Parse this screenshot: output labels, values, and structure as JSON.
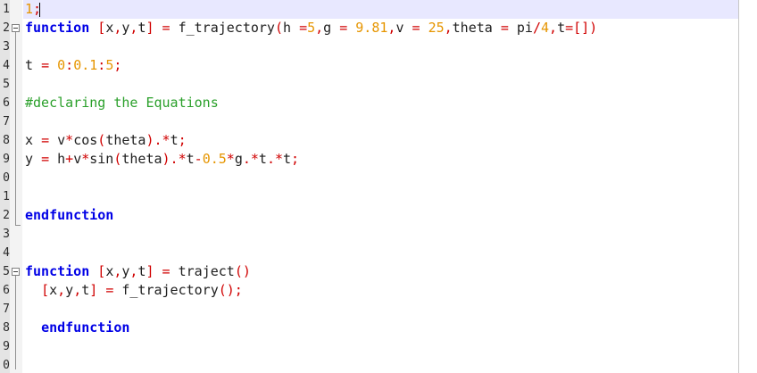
{
  "gutter": {
    "line_numbers": [
      "1",
      "2",
      "3",
      "4",
      "5",
      "6",
      "7",
      "8",
      "9",
      "0",
      "1",
      "2",
      "3",
      "4",
      "5",
      "6",
      "7",
      "8",
      "9",
      "0"
    ]
  },
  "colors": {
    "keyword": "#0000e6",
    "operator": "#d00000",
    "number": "#e69500",
    "comment": "#2ba02b",
    "identifier": "#202020",
    "current_line": "#e8e8ff"
  },
  "lines": [
    [
      {
        "t": "1",
        "c": "num"
      },
      {
        "t": ";",
        "c": "op"
      }
    ],
    [
      {
        "t": "function",
        "c": "kw"
      },
      {
        "t": " ",
        "c": "id"
      },
      {
        "t": "[",
        "c": "op"
      },
      {
        "t": "x",
        "c": "id"
      },
      {
        "t": ",",
        "c": "op"
      },
      {
        "t": "y",
        "c": "id"
      },
      {
        "t": ",",
        "c": "op"
      },
      {
        "t": "t",
        "c": "id"
      },
      {
        "t": "]",
        "c": "op"
      },
      {
        "t": " ",
        "c": "id"
      },
      {
        "t": "=",
        "c": "op"
      },
      {
        "t": " f_trajectory",
        "c": "id"
      },
      {
        "t": "(",
        "c": "op"
      },
      {
        "t": "h ",
        "c": "id"
      },
      {
        "t": "=",
        "c": "op"
      },
      {
        "t": "5",
        "c": "num"
      },
      {
        "t": ",",
        "c": "op"
      },
      {
        "t": "g ",
        "c": "id"
      },
      {
        "t": "=",
        "c": "op"
      },
      {
        "t": " ",
        "c": "id"
      },
      {
        "t": "9.81",
        "c": "num"
      },
      {
        "t": ",",
        "c": "op"
      },
      {
        "t": "v ",
        "c": "id"
      },
      {
        "t": "=",
        "c": "op"
      },
      {
        "t": " ",
        "c": "id"
      },
      {
        "t": "25",
        "c": "num"
      },
      {
        "t": ",",
        "c": "op"
      },
      {
        "t": "theta ",
        "c": "id"
      },
      {
        "t": "=",
        "c": "op"
      },
      {
        "t": " pi",
        "c": "id"
      },
      {
        "t": "/",
        "c": "op"
      },
      {
        "t": "4",
        "c": "num"
      },
      {
        "t": ",",
        "c": "op"
      },
      {
        "t": "t",
        "c": "id"
      },
      {
        "t": "=[])",
        "c": "op"
      }
    ],
    [],
    [
      {
        "t": "t ",
        "c": "id"
      },
      {
        "t": "=",
        "c": "op"
      },
      {
        "t": " ",
        "c": "id"
      },
      {
        "t": "0",
        "c": "num"
      },
      {
        "t": ":",
        "c": "op"
      },
      {
        "t": "0.1",
        "c": "num"
      },
      {
        "t": ":",
        "c": "op"
      },
      {
        "t": "5",
        "c": "num"
      },
      {
        "t": ";",
        "c": "op"
      }
    ],
    [],
    [
      {
        "t": "#declaring the Equations",
        "c": "cm"
      }
    ],
    [],
    [
      {
        "t": "x ",
        "c": "id"
      },
      {
        "t": "=",
        "c": "op"
      },
      {
        "t": " v",
        "c": "id"
      },
      {
        "t": "*",
        "c": "op"
      },
      {
        "t": "cos",
        "c": "id"
      },
      {
        "t": "(",
        "c": "op"
      },
      {
        "t": "theta",
        "c": "id"
      },
      {
        "t": ").*",
        "c": "op"
      },
      {
        "t": "t",
        "c": "id"
      },
      {
        "t": ";",
        "c": "op"
      }
    ],
    [
      {
        "t": "y ",
        "c": "id"
      },
      {
        "t": "=",
        "c": "op"
      },
      {
        "t": " h",
        "c": "id"
      },
      {
        "t": "+",
        "c": "op"
      },
      {
        "t": "v",
        "c": "id"
      },
      {
        "t": "*",
        "c": "op"
      },
      {
        "t": "sin",
        "c": "id"
      },
      {
        "t": "(",
        "c": "op"
      },
      {
        "t": "theta",
        "c": "id"
      },
      {
        "t": ").*",
        "c": "op"
      },
      {
        "t": "t",
        "c": "id"
      },
      {
        "t": "-",
        "c": "op"
      },
      {
        "t": "0.5",
        "c": "num"
      },
      {
        "t": "*",
        "c": "op"
      },
      {
        "t": "g",
        "c": "id"
      },
      {
        "t": ".*",
        "c": "op"
      },
      {
        "t": "t",
        "c": "id"
      },
      {
        "t": ".*",
        "c": "op"
      },
      {
        "t": "t",
        "c": "id"
      },
      {
        "t": ";",
        "c": "op"
      }
    ],
    [],
    [],
    [
      {
        "t": "endfunction",
        "c": "kw"
      }
    ],
    [],
    [],
    [
      {
        "t": "function",
        "c": "kw"
      },
      {
        "t": " ",
        "c": "id"
      },
      {
        "t": "[",
        "c": "op"
      },
      {
        "t": "x",
        "c": "id"
      },
      {
        "t": ",",
        "c": "op"
      },
      {
        "t": "y",
        "c": "id"
      },
      {
        "t": ",",
        "c": "op"
      },
      {
        "t": "t",
        "c": "id"
      },
      {
        "t": "]",
        "c": "op"
      },
      {
        "t": " ",
        "c": "id"
      },
      {
        "t": "=",
        "c": "op"
      },
      {
        "t": " traject",
        "c": "id"
      },
      {
        "t": "()",
        "c": "op"
      }
    ],
    [
      {
        "t": "  ",
        "c": "id"
      },
      {
        "t": "[",
        "c": "op"
      },
      {
        "t": "x",
        "c": "id"
      },
      {
        "t": ",",
        "c": "op"
      },
      {
        "t": "y",
        "c": "id"
      },
      {
        "t": ",",
        "c": "op"
      },
      {
        "t": "t",
        "c": "id"
      },
      {
        "t": "]",
        "c": "op"
      },
      {
        "t": " ",
        "c": "id"
      },
      {
        "t": "=",
        "c": "op"
      },
      {
        "t": " f_trajectory",
        "c": "id"
      },
      {
        "t": "();",
        "c": "op"
      }
    ],
    [],
    [
      {
        "t": "  ",
        "c": "id"
      },
      {
        "t": "endfunction",
        "c": "kw"
      }
    ],
    [],
    []
  ]
}
